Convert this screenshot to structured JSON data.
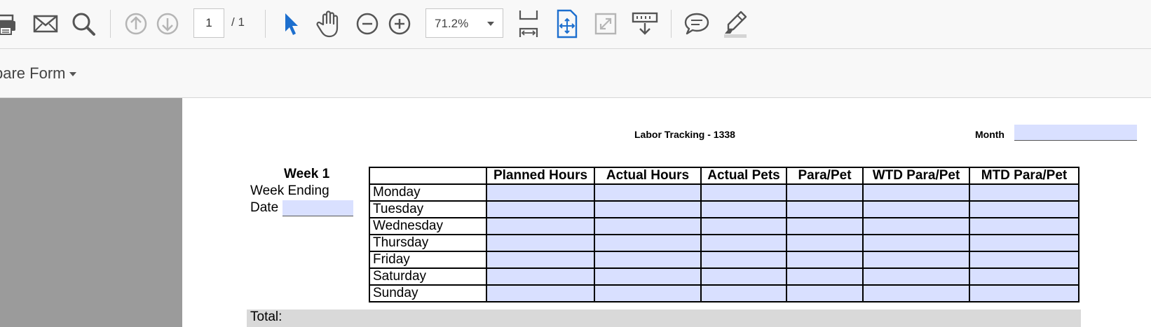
{
  "toolbar": {
    "page_current": "1",
    "page_total": "/ 1",
    "zoom": "71.2%"
  },
  "secondbar": {
    "prepare_form": "pare Form"
  },
  "document": {
    "title": "Labor Tracking - 1338",
    "month_label": "Month",
    "week_title": "Week 1",
    "week_ending": "Week Ending",
    "date_label": "Date",
    "columns": [
      "Planned Hours",
      "Actual Hours",
      "Actual Pets",
      "Para/Pet",
      "WTD Para/Pet",
      "MTD Para/Pet"
    ],
    "days": [
      "Monday",
      "Tuesday",
      "Wednesday",
      "Thursday",
      "Friday",
      "Saturday",
      "Sunday"
    ],
    "total_label": "Total:"
  }
}
